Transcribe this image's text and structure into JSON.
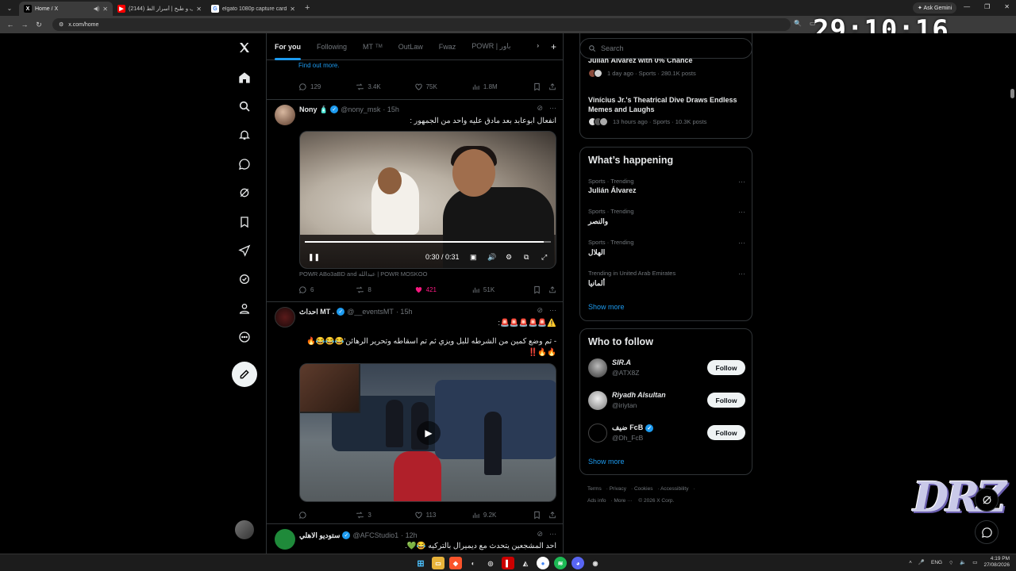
{
  "browser": {
    "tabs": [
      {
        "title": "Home / X",
        "favicon": "X",
        "active": true
      },
      {
        "title": "سوالف و طبخ | أسرار الط (2144)",
        "favicon": "▶",
        "active": false
      },
      {
        "title": "elgato 1080p capture card - Go",
        "favicon": "G",
        "active": false
      }
    ],
    "gemini_label": "Ask Gemini",
    "url": "x.com/home"
  },
  "overlay": {
    "timer": "29:10:16",
    "logo": "DRZ"
  },
  "timeline": {
    "tabs": [
      {
        "label": "For you",
        "sub": "",
        "active": true
      },
      {
        "label": "Following",
        "sub": "",
        "active": false
      },
      {
        "label": "MT",
        "sub": "TM",
        "active": false
      },
      {
        "label": "OutLaw",
        "sub": "",
        "active": false
      },
      {
        "label": "Fwaz",
        "sub": "",
        "active": false
      },
      {
        "label": "POWR | باور",
        "sub": "",
        "active": false
      }
    ],
    "find_out_more": "Find out more.",
    "post0_actions": {
      "replies": "129",
      "reposts": "3.4K",
      "likes": "75K",
      "views": "1.8M"
    },
    "post1": {
      "name": "Nony 🧴",
      "handle": "@nony_msk",
      "time": "· 15h",
      "text": "انفعال ابوعابد بعد مادق عليه واحد من الجمهور :",
      "video_time": "0:30 / 0:31",
      "video_progress": 0.97,
      "caption": "POWR ABo3aBD and عبدالله | POWR MOSKOO",
      "actions": {
        "replies": "6",
        "reposts": "8",
        "likes": "421",
        "views": "51K"
      }
    },
    "post2": {
      "name": "احداث MT .",
      "handle": "@__eventsMT",
      "time": "· 15h",
      "line1": "⚠️🚨🚨🚨🚨🚨:",
      "line2": "- تم وضع كمين من الشرطه للبل ويزي ثم تم اسقاطه وتحرير الرهائن'😂😂😂🔥🔥🔥‼️",
      "actions": {
        "replies": "",
        "reposts": "3",
        "likes": "113",
        "views": "9.2K"
      }
    },
    "post3": {
      "name": "ستوديو الاهلي",
      "handle": "@AFCStudio1",
      "time": "· 12h",
      "text": "احد المشجعين يتحدث مع ديميرال بالتركيه 😂💚."
    }
  },
  "right": {
    "search_placeholder": "Search",
    "trend_top": {
      "title": "Julián Álvarez with 0% Chance",
      "meta": "1 day ago · Sports · 280.1K posts"
    },
    "trend2": {
      "title": "Vinícius Jr.'s Theatrical Dive Draws Endless Memes and Laughs",
      "meta": "13 hours ago · Sports · 10.3K posts"
    },
    "whats_happening": "What’s happening",
    "trending": [
      {
        "category": "Sports · Trending",
        "name": "Julián Álvarez"
      },
      {
        "category": "Sports · Trending",
        "name": "والنصر"
      },
      {
        "category": "Sports · Trending",
        "name": "الهلال"
      },
      {
        "category": "Trending in United Arab Emirates",
        "name": "ألمانيا"
      }
    ],
    "show_more": "Show more",
    "who_to_follow": "Who to follow",
    "follow": [
      {
        "name": "SIR.A",
        "handle": "@ATX8Z",
        "verified": false
      },
      {
        "name": "Riyadh Alsultan",
        "handle": "@iriytan",
        "verified": false
      },
      {
        "name": "ضيف FcB",
        "handle": "@Dh_FcB",
        "verified": true
      }
    ],
    "follow_label": "Follow",
    "footer": [
      "Terms",
      "Privacy",
      "Cookies",
      "Accessibility",
      "Ads info",
      "More ···",
      "© 2026 X Corp."
    ]
  },
  "taskbar": {
    "lang": "ENG",
    "time": "4:19 PM",
    "date": "27/08/2026"
  },
  "colors": {
    "accent": "#1d9bf0",
    "like": "#f91880",
    "background": "#000000"
  }
}
